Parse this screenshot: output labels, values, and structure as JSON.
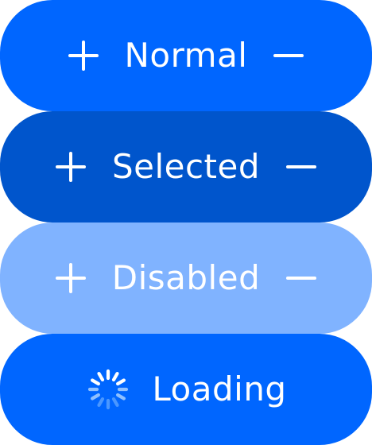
{
  "buttons": [
    {
      "state": "normal",
      "label": "Normal",
      "left_icon": "plus-icon",
      "right_icon": "minus-icon",
      "color": "#0066FF"
    },
    {
      "state": "selected",
      "label": "Selected",
      "left_icon": "plus-icon",
      "right_icon": "minus-icon",
      "color": "#0055CC"
    },
    {
      "state": "disabled",
      "label": "Disabled",
      "left_icon": "plus-icon",
      "right_icon": "minus-icon",
      "color": "#80B3FF"
    },
    {
      "state": "loading",
      "label": "Loading",
      "left_icon": "spinner-icon",
      "color": "#0066FF"
    }
  ],
  "colors": {
    "text": "#FFFFFF",
    "spinner_light": "#8FC0FF",
    "spinner_mid": "#4A97FF"
  }
}
